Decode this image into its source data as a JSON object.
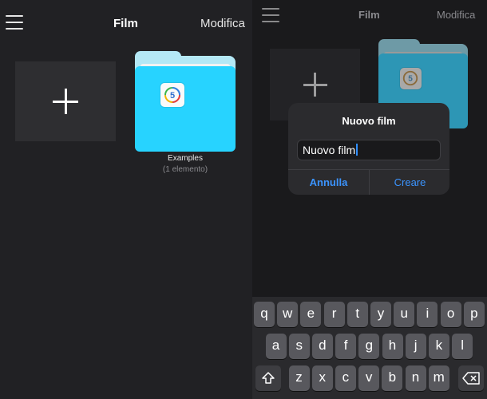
{
  "left": {
    "title": "Film",
    "edit_label": "Modifica",
    "folder": {
      "name": "Examples",
      "count": "(1 elemento)",
      "badge_digit": "5"
    }
  },
  "right": {
    "title": "Film",
    "edit_label": "Modifica",
    "folder": {
      "badge_digit": "5"
    },
    "dialog": {
      "title": "Nuovo film",
      "input_value": "Nuovo film",
      "cancel_label": "Annulla",
      "create_label": "Creare"
    },
    "keyboard": {
      "row1": [
        "q",
        "w",
        "e",
        "r",
        "t",
        "y",
        "u",
        "i",
        "o",
        "p"
      ],
      "row2": [
        "a",
        "s",
        "d",
        "f",
        "g",
        "h",
        "j",
        "k",
        "l"
      ],
      "row3": [
        "z",
        "x",
        "c",
        "v",
        "b",
        "n",
        "m"
      ]
    }
  },
  "colors": {
    "accent": "#3b94ff",
    "folder_front": "#27d3ff",
    "folder_back": "#b4e8f5",
    "folder_front_dim": "#2d96b5",
    "folder_back_dim": "#6e9aa6"
  },
  "icons": [
    "menu-icon",
    "plus-icon",
    "folder-icon",
    "app-logo-icon",
    "shift-icon",
    "backspace-icon"
  ]
}
